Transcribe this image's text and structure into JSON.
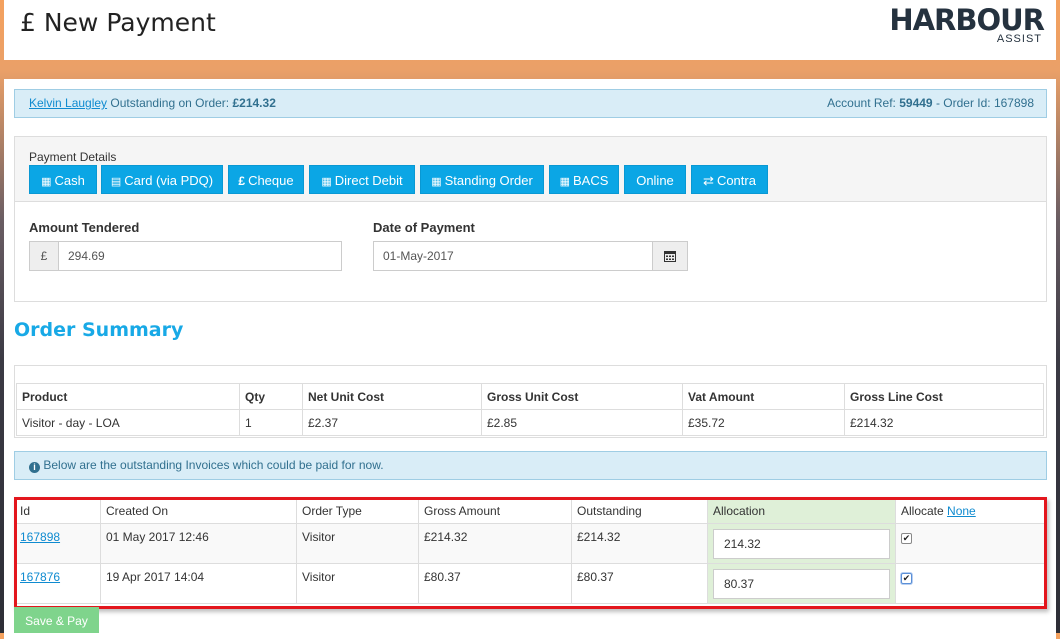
{
  "header": {
    "title": "£ New Payment",
    "logo_main": "HARBOUR",
    "logo_sub": "ASSIST"
  },
  "order_bar": {
    "customer_name": "Kelvin Laugley",
    "outstanding_label": "Outstanding on Order:",
    "outstanding_value": "£214.32",
    "account_ref_label": "Account Ref:",
    "account_ref": "59449",
    "order_id_label": "- Order Id: 167898"
  },
  "payment": {
    "details_label": "Payment Details",
    "methods": [
      {
        "label": "Cash",
        "icon": "money-icon"
      },
      {
        "label": "Card (via PDQ)",
        "icon": "credit-card-icon"
      },
      {
        "label": "Cheque",
        "icon": "pound-icon"
      },
      {
        "label": "Direct Debit",
        "icon": "calendar-icon"
      },
      {
        "label": "Standing Order",
        "icon": "calendar-icon"
      },
      {
        "label": "BACS",
        "icon": "calendar-icon"
      },
      {
        "label": "Online",
        "icon": ""
      },
      {
        "label": "Contra",
        "icon": "exchange-icon"
      }
    ],
    "amount_label": "Amount Tendered",
    "currency_symbol": "£",
    "amount_value": "294.69",
    "date_label": "Date of Payment",
    "date_value": "01-May-2017"
  },
  "order_summary": {
    "title": "Order Summary",
    "columns": [
      "Product",
      "Qty",
      "Net Unit Cost",
      "Gross Unit Cost",
      "Vat Amount",
      "Gross Line Cost"
    ],
    "rows": [
      [
        "Visitor - day - LOA",
        "1",
        "£2.37",
        "£2.85",
        "£35.72",
        "£214.32"
      ]
    ]
  },
  "invoices_notice": "Below are the outstanding Invoices which could be paid for now.",
  "invoices": {
    "columns": [
      "Id",
      "Created On",
      "Order Type",
      "Gross Amount",
      "Outstanding",
      "Allocation",
      "Allocate"
    ],
    "allocate_none_link": "None",
    "rows": [
      {
        "id": "167898",
        "created": "01 May 2017 12:46",
        "type": "Visitor",
        "gross": "£214.32",
        "outstanding": "£214.32",
        "allocation": "214.32",
        "checked": true
      },
      {
        "id": "167876",
        "created": "19 Apr 2017 14:04",
        "type": "Visitor",
        "gross": "£80.37",
        "outstanding": "£80.37",
        "allocation": "80.37",
        "checked": true
      }
    ]
  },
  "save_label": "Save & Pay",
  "colors": {
    "accent": "#0ba6e5",
    "info_bg": "#d9edf7",
    "allocation_bg": "#dff0d8",
    "highlight": "#e3161d",
    "save_button": "#7fd48c"
  }
}
